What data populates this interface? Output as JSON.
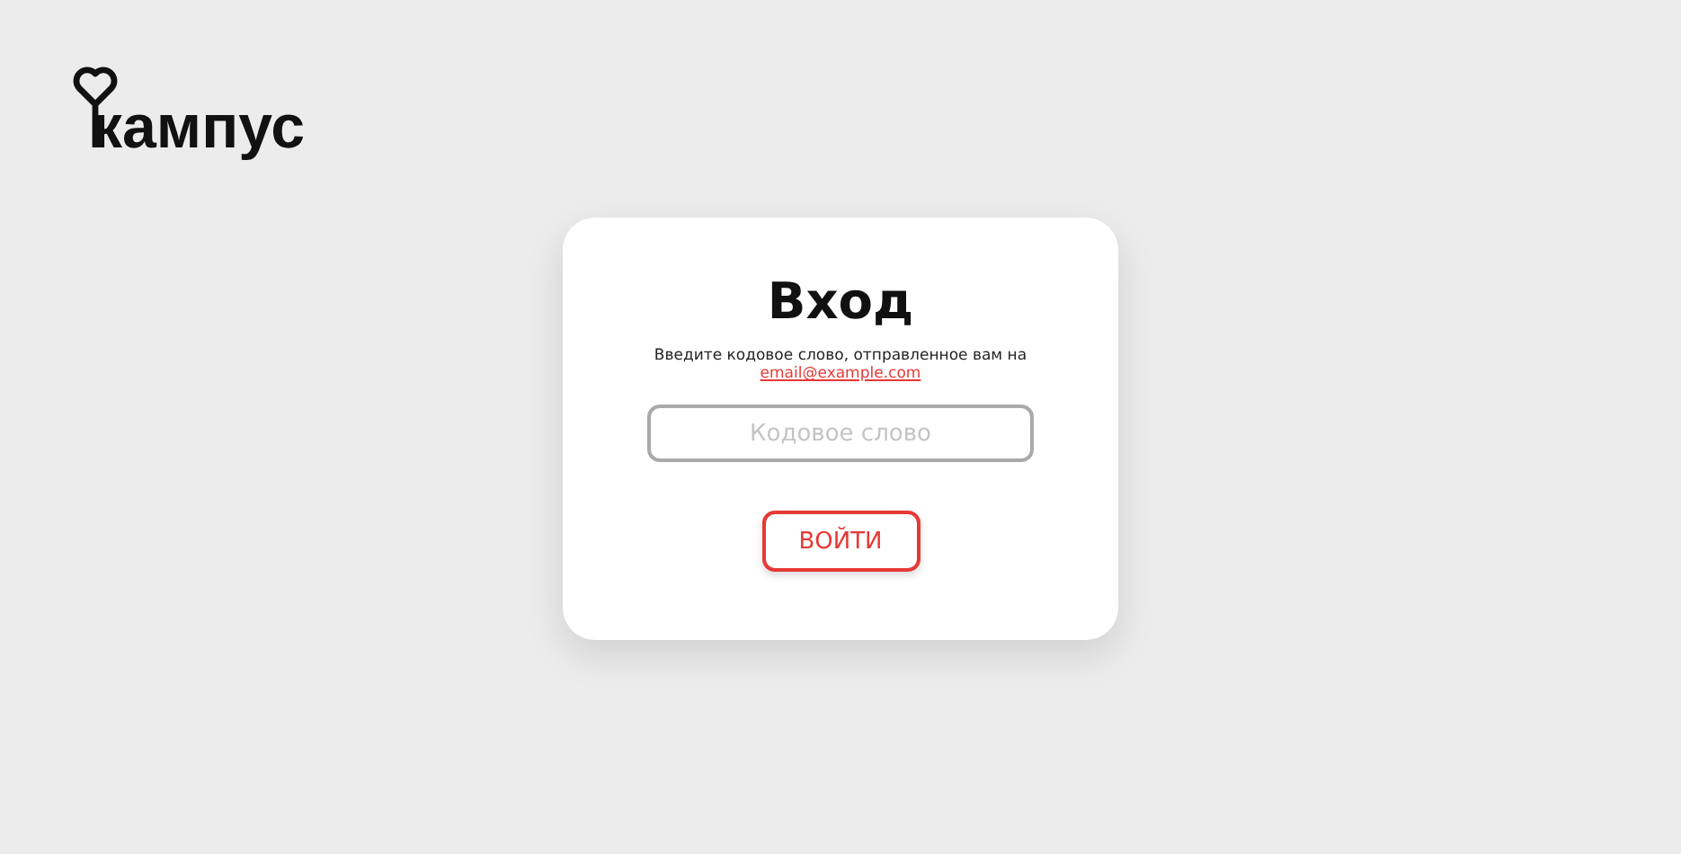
{
  "logo": {
    "text": "кампус"
  },
  "card": {
    "title": "Вход",
    "message": "Введите кодовое слово, отправленное вам на",
    "email_link": "email@example.com",
    "code_field": {
      "placeholder": "Кодовое слово"
    },
    "submit_button": {
      "label": "ВОЙТИ"
    }
  }
}
